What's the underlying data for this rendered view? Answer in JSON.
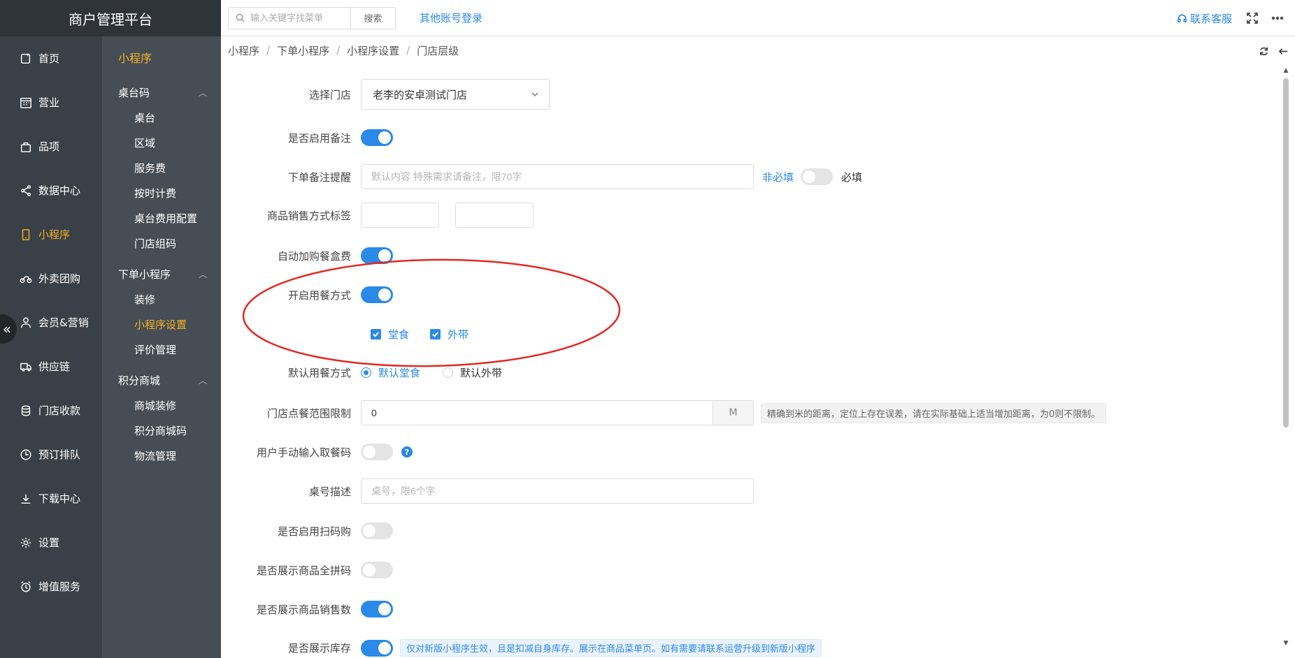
{
  "app": {
    "title": "商户管理平台"
  },
  "main_nav": [
    {
      "label": "首页",
      "icon": "home-icon"
    },
    {
      "label": "营业",
      "icon": "calendar-icon"
    },
    {
      "label": "品项",
      "icon": "bag-icon"
    },
    {
      "label": "数据中心",
      "icon": "share-icon"
    },
    {
      "label": "小程序",
      "icon": "phone-icon",
      "active": true
    },
    {
      "label": "外卖团购",
      "icon": "bike-icon"
    },
    {
      "label": "会员&营销",
      "icon": "user-icon"
    },
    {
      "label": "供应链",
      "icon": "truck-icon"
    },
    {
      "label": "门店收款",
      "icon": "database-icon"
    },
    {
      "label": "预订排队",
      "icon": "clock-icon"
    },
    {
      "label": "下载中心",
      "icon": "download-icon"
    },
    {
      "label": "设置",
      "icon": "gear-icon"
    },
    {
      "label": "增值服务",
      "icon": "alarm-icon"
    }
  ],
  "sub_nav": {
    "title": "小程序",
    "groups": [
      {
        "label": "桌台码",
        "items": [
          "桌台",
          "区域",
          "服务费",
          "按时计费",
          "桌台费用配置",
          "门店组码"
        ]
      },
      {
        "label": "下单小程序",
        "items": [
          "装修",
          "小程序设置",
          "评价管理"
        ]
      },
      {
        "label": "积分商城",
        "items": [
          "商城装修",
          "积分商城码",
          "物流管理"
        ]
      }
    ],
    "active_item": "小程序设置"
  },
  "topbar": {
    "search_placeholder": "输入关键字找菜单",
    "search_button": "搜索",
    "other_login": "其他账号登录",
    "service": "联系客服"
  },
  "breadcrumb": [
    "小程序",
    "下单小程序",
    "小程序设置",
    "门店层级"
  ],
  "form": {
    "store": {
      "label": "选择门店",
      "value": "老李的安卓测试门店"
    },
    "enable_remark": {
      "label": "是否启用备注",
      "on": true
    },
    "remark_hint": {
      "label": "下单备注提醒",
      "placeholder": "默认内容 特殊需求请备注，限70字",
      "optional": "非必填",
      "required": "必填",
      "on": false
    },
    "sale_tag": {
      "label": "商品销售方式标签",
      "value1": "",
      "value2": ""
    },
    "auto_box_fee": {
      "label": "自动加购餐盒费",
      "on": true
    },
    "dining_mode": {
      "label": "开启用餐方式",
      "on": true,
      "options": [
        "堂食",
        "外带"
      ]
    },
    "default_mode": {
      "label": "默认用餐方式",
      "options": [
        "默认堂食",
        "默认外带"
      ],
      "selected": "默认堂食"
    },
    "range_limit": {
      "label": "门店点餐范围限制",
      "value": "0",
      "unit": "M",
      "hint": "精确到米的距离，定位上存在误差，请在实际基础上适当增加距离，为0则不限制。"
    },
    "manual_pickup": {
      "label": "用户手动输入取餐码",
      "on": false,
      "help": "?"
    },
    "table_desc": {
      "label": "桌号描述",
      "placeholder": "桌号，限6个字"
    },
    "scan_buy": {
      "label": "是否启用扫码购",
      "on": false
    },
    "pinyin_code": {
      "label": "是否展示商品全拼码",
      "on": false
    },
    "sales_count": {
      "label": "是否展示商品销售数",
      "on": true
    },
    "stock": {
      "label": "是否展示库存",
      "on": true,
      "hint": "仅对新版小程序生效，且是扣减自身库存。展示在商品菜单页。如有需要请联系运营升级到新版小程序"
    }
  },
  "colors": {
    "accent": "#2b89e8",
    "active_nav": "#f5b323",
    "annotation": "#e02a23",
    "sidebar": "#3a4047",
    "subsidebar": "#464d55"
  }
}
